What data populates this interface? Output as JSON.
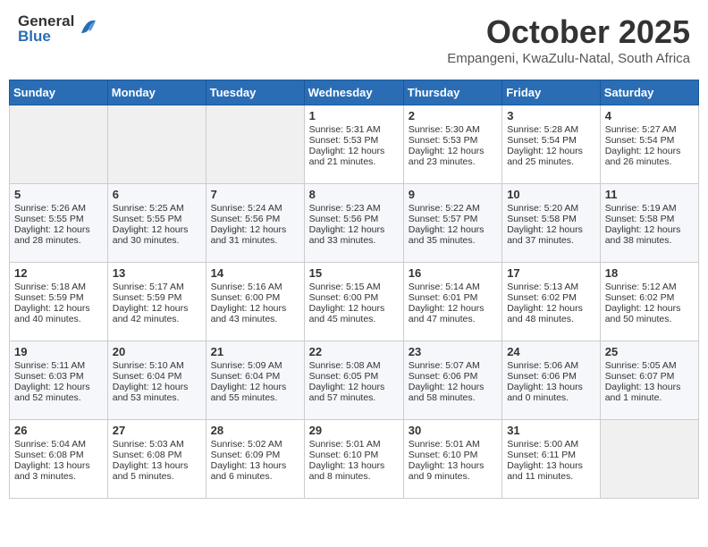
{
  "header": {
    "logo_general": "General",
    "logo_blue": "Blue",
    "month": "October 2025",
    "location": "Empangeni, KwaZulu-Natal, South Africa"
  },
  "days_of_week": [
    "Sunday",
    "Monday",
    "Tuesday",
    "Wednesday",
    "Thursday",
    "Friday",
    "Saturday"
  ],
  "weeks": [
    [
      {
        "day": "",
        "sunrise": "",
        "sunset": "",
        "daylight": ""
      },
      {
        "day": "",
        "sunrise": "",
        "sunset": "",
        "daylight": ""
      },
      {
        "day": "",
        "sunrise": "",
        "sunset": "",
        "daylight": ""
      },
      {
        "day": "1",
        "sunrise": "Sunrise: 5:31 AM",
        "sunset": "Sunset: 5:53 PM",
        "daylight": "Daylight: 12 hours and 21 minutes."
      },
      {
        "day": "2",
        "sunrise": "Sunrise: 5:30 AM",
        "sunset": "Sunset: 5:53 PM",
        "daylight": "Daylight: 12 hours and 23 minutes."
      },
      {
        "day": "3",
        "sunrise": "Sunrise: 5:28 AM",
        "sunset": "Sunset: 5:54 PM",
        "daylight": "Daylight: 12 hours and 25 minutes."
      },
      {
        "day": "4",
        "sunrise": "Sunrise: 5:27 AM",
        "sunset": "Sunset: 5:54 PM",
        "daylight": "Daylight: 12 hours and 26 minutes."
      }
    ],
    [
      {
        "day": "5",
        "sunrise": "Sunrise: 5:26 AM",
        "sunset": "Sunset: 5:55 PM",
        "daylight": "Daylight: 12 hours and 28 minutes."
      },
      {
        "day": "6",
        "sunrise": "Sunrise: 5:25 AM",
        "sunset": "Sunset: 5:55 PM",
        "daylight": "Daylight: 12 hours and 30 minutes."
      },
      {
        "day": "7",
        "sunrise": "Sunrise: 5:24 AM",
        "sunset": "Sunset: 5:56 PM",
        "daylight": "Daylight: 12 hours and 31 minutes."
      },
      {
        "day": "8",
        "sunrise": "Sunrise: 5:23 AM",
        "sunset": "Sunset: 5:56 PM",
        "daylight": "Daylight: 12 hours and 33 minutes."
      },
      {
        "day": "9",
        "sunrise": "Sunrise: 5:22 AM",
        "sunset": "Sunset: 5:57 PM",
        "daylight": "Daylight: 12 hours and 35 minutes."
      },
      {
        "day": "10",
        "sunrise": "Sunrise: 5:20 AM",
        "sunset": "Sunset: 5:58 PM",
        "daylight": "Daylight: 12 hours and 37 minutes."
      },
      {
        "day": "11",
        "sunrise": "Sunrise: 5:19 AM",
        "sunset": "Sunset: 5:58 PM",
        "daylight": "Daylight: 12 hours and 38 minutes."
      }
    ],
    [
      {
        "day": "12",
        "sunrise": "Sunrise: 5:18 AM",
        "sunset": "Sunset: 5:59 PM",
        "daylight": "Daylight: 12 hours and 40 minutes."
      },
      {
        "day": "13",
        "sunrise": "Sunrise: 5:17 AM",
        "sunset": "Sunset: 5:59 PM",
        "daylight": "Daylight: 12 hours and 42 minutes."
      },
      {
        "day": "14",
        "sunrise": "Sunrise: 5:16 AM",
        "sunset": "Sunset: 6:00 PM",
        "daylight": "Daylight: 12 hours and 43 minutes."
      },
      {
        "day": "15",
        "sunrise": "Sunrise: 5:15 AM",
        "sunset": "Sunset: 6:00 PM",
        "daylight": "Daylight: 12 hours and 45 minutes."
      },
      {
        "day": "16",
        "sunrise": "Sunrise: 5:14 AM",
        "sunset": "Sunset: 6:01 PM",
        "daylight": "Daylight: 12 hours and 47 minutes."
      },
      {
        "day": "17",
        "sunrise": "Sunrise: 5:13 AM",
        "sunset": "Sunset: 6:02 PM",
        "daylight": "Daylight: 12 hours and 48 minutes."
      },
      {
        "day": "18",
        "sunrise": "Sunrise: 5:12 AM",
        "sunset": "Sunset: 6:02 PM",
        "daylight": "Daylight: 12 hours and 50 minutes."
      }
    ],
    [
      {
        "day": "19",
        "sunrise": "Sunrise: 5:11 AM",
        "sunset": "Sunset: 6:03 PM",
        "daylight": "Daylight: 12 hours and 52 minutes."
      },
      {
        "day": "20",
        "sunrise": "Sunrise: 5:10 AM",
        "sunset": "Sunset: 6:04 PM",
        "daylight": "Daylight: 12 hours and 53 minutes."
      },
      {
        "day": "21",
        "sunrise": "Sunrise: 5:09 AM",
        "sunset": "Sunset: 6:04 PM",
        "daylight": "Daylight: 12 hours and 55 minutes."
      },
      {
        "day": "22",
        "sunrise": "Sunrise: 5:08 AM",
        "sunset": "Sunset: 6:05 PM",
        "daylight": "Daylight: 12 hours and 57 minutes."
      },
      {
        "day": "23",
        "sunrise": "Sunrise: 5:07 AM",
        "sunset": "Sunset: 6:06 PM",
        "daylight": "Daylight: 12 hours and 58 minutes."
      },
      {
        "day": "24",
        "sunrise": "Sunrise: 5:06 AM",
        "sunset": "Sunset: 6:06 PM",
        "daylight": "Daylight: 13 hours and 0 minutes."
      },
      {
        "day": "25",
        "sunrise": "Sunrise: 5:05 AM",
        "sunset": "Sunset: 6:07 PM",
        "daylight": "Daylight: 13 hours and 1 minute."
      }
    ],
    [
      {
        "day": "26",
        "sunrise": "Sunrise: 5:04 AM",
        "sunset": "Sunset: 6:08 PM",
        "daylight": "Daylight: 13 hours and 3 minutes."
      },
      {
        "day": "27",
        "sunrise": "Sunrise: 5:03 AM",
        "sunset": "Sunset: 6:08 PM",
        "daylight": "Daylight: 13 hours and 5 minutes."
      },
      {
        "day": "28",
        "sunrise": "Sunrise: 5:02 AM",
        "sunset": "Sunset: 6:09 PM",
        "daylight": "Daylight: 13 hours and 6 minutes."
      },
      {
        "day": "29",
        "sunrise": "Sunrise: 5:01 AM",
        "sunset": "Sunset: 6:10 PM",
        "daylight": "Daylight: 13 hours and 8 minutes."
      },
      {
        "day": "30",
        "sunrise": "Sunrise: 5:01 AM",
        "sunset": "Sunset: 6:10 PM",
        "daylight": "Daylight: 13 hours and 9 minutes."
      },
      {
        "day": "31",
        "sunrise": "Sunrise: 5:00 AM",
        "sunset": "Sunset: 6:11 PM",
        "daylight": "Daylight: 13 hours and 11 minutes."
      },
      {
        "day": "",
        "sunrise": "",
        "sunset": "",
        "daylight": ""
      }
    ]
  ]
}
